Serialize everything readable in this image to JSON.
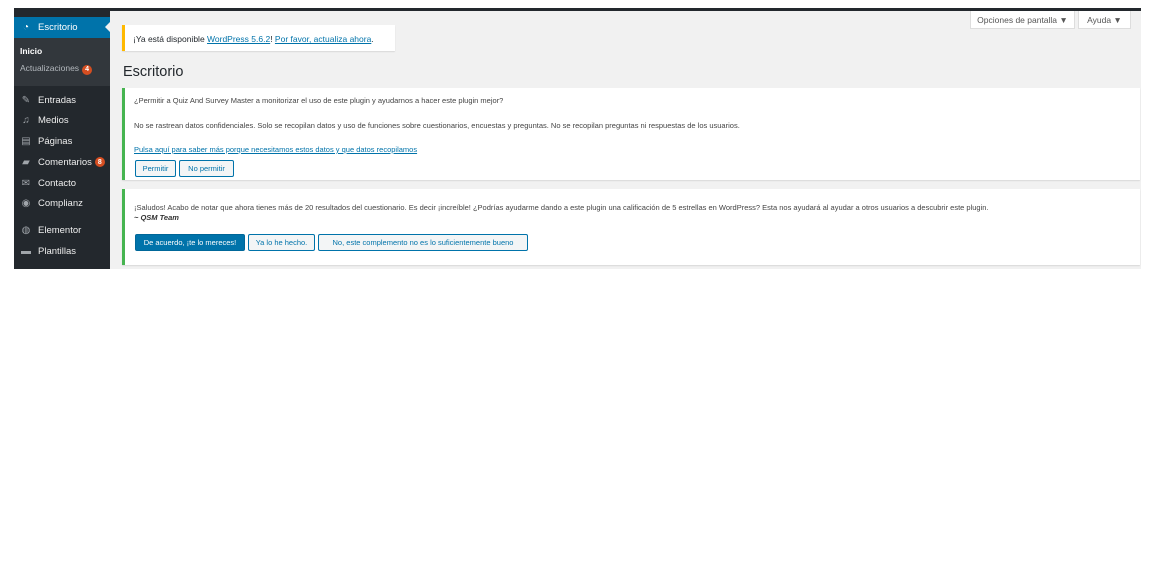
{
  "sidebar": {
    "dashboard": {
      "label": "Escritorio",
      "icon": "dashboard-icon"
    },
    "submenu": {
      "home": "Inicio",
      "updates": "Actualizaciones",
      "updates_count": "4"
    },
    "items": [
      {
        "label": "Entradas",
        "icon": "pin-icon",
        "glyph": "✎"
      },
      {
        "label": "Medios",
        "icon": "media-icon",
        "glyph": "♫"
      },
      {
        "label": "Páginas",
        "icon": "page-icon",
        "glyph": "▤"
      },
      {
        "label": "Comentarios",
        "icon": "comment-icon",
        "glyph": "▰",
        "badge": "8"
      },
      {
        "label": "Contacto",
        "icon": "mail-icon",
        "glyph": "✉"
      },
      {
        "label": "Complianz",
        "icon": "complianz-icon",
        "glyph": "◉"
      },
      {
        "label": "Elementor",
        "icon": "elementor-icon",
        "glyph": "◍"
      },
      {
        "label": "Plantillas",
        "icon": "folder-icon",
        "glyph": "▬"
      }
    ]
  },
  "screen_meta": {
    "options_label": "Opciones de pantalla ▼",
    "help_label": "Ayuda ▼"
  },
  "update_nag": {
    "prefix": "¡Ya está disponible ",
    "version_link": "WordPress 5.6.2",
    "middle": "! ",
    "update_link": "Por favor, actualiza ahora",
    "suffix": "."
  },
  "page_title": "Escritorio",
  "tracking_notice": {
    "question": "¿Permitir a Quiz And Survey Master a monitorizar el uso de este plugin y ayudarnos a hacer este plugin mejor?",
    "info": "No se rastrean datos confidenciales. Solo se recopilan datos y uso de funciones sobre cuestionarios, encuestas y preguntas. No se recopilan preguntas ni respuestas de los usuarios.",
    "learn_more_link": "Pulsa aquí para saber más porque necesitamos estos datos y que datos recopilamos",
    "allow_button": "Permitir",
    "deny_button": "No permitir"
  },
  "review_notice": {
    "message": "¡Saludos! Acabo de notar que ahora tienes más de 20 resultados del cuestionario. Es decir ¡increíble! ¿Podrías ayudarme dando a este plugin una calificación de 5 estrellas en WordPress? Esta nos ayudará al ayudar a otros usuarios a descubrir este plugin.",
    "signature": "~ QSM Team",
    "agree_button": "De acuerdo, ¡te lo mereces!",
    "done_button": "Ya lo he hecho.",
    "no_button": "No, este complemento no es lo suficientemente bueno"
  },
  "colors": {
    "sidebar_bg": "#23282d",
    "accent": "#0073aa",
    "notice_success": "#46b450",
    "notice_warning": "#ffb900",
    "badge": "#d54e21"
  }
}
